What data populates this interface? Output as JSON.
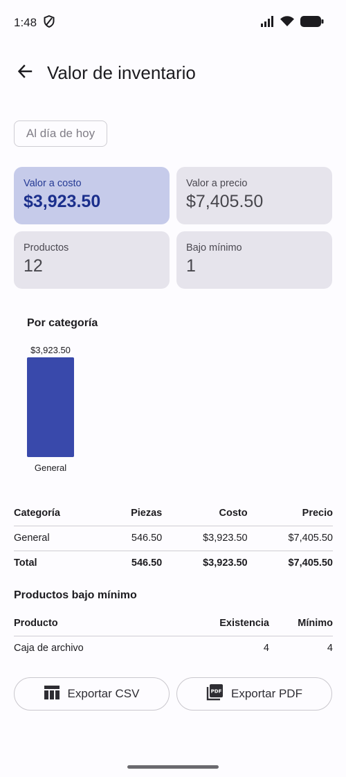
{
  "status": {
    "time": "1:48"
  },
  "header": {
    "title": "Valor de inventario"
  },
  "filter": {
    "date_label": "Al día de hoy"
  },
  "cards": [
    {
      "label": "Valor a costo",
      "value": "$3,923.50"
    },
    {
      "label": "Valor a precio",
      "value": "$7,405.50"
    },
    {
      "label": "Productos",
      "value": "12"
    },
    {
      "label": "Bajo mínimo",
      "value": "1"
    }
  ],
  "chart_section": {
    "title": "Por categoría"
  },
  "chart_data": {
    "type": "bar",
    "categories": [
      "General"
    ],
    "values": [
      3923.5
    ],
    "value_labels": [
      "$3,923.50"
    ],
    "ylim": [
      0,
      3923.5
    ],
    "bar_color": "#3949ab"
  },
  "category_table": {
    "headers": [
      "Categoría",
      "Piezas",
      "Costo",
      "Precio"
    ],
    "rows": [
      [
        "General",
        "546.50",
        "$3,923.50",
        "$7,405.50"
      ]
    ],
    "total": [
      "Total",
      "546.50",
      "$3,923.50",
      "$7,405.50"
    ]
  },
  "low_stock": {
    "title": "Productos bajo mínimo",
    "headers": [
      "Producto",
      "Existencia",
      "Mínimo"
    ],
    "rows": [
      [
        "Caja de archivo",
        "4",
        "4"
      ]
    ]
  },
  "actions": {
    "export_csv": "Exportar CSV",
    "export_pdf": "Exportar PDF"
  },
  "colors": {
    "accent": "#3949ab",
    "primary_card": "#c6cbea",
    "card": "#e6e4ec"
  }
}
